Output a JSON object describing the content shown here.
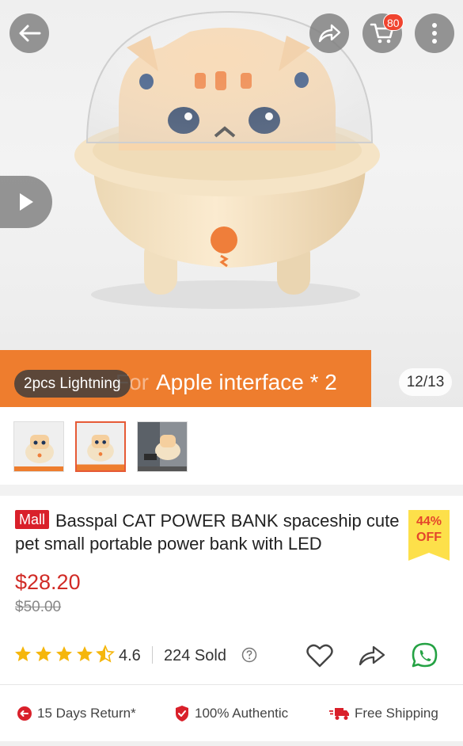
{
  "header": {
    "cart_count": "80"
  },
  "gallery": {
    "variant_label": "Apple interface * 2",
    "variant_ghost": "For",
    "variant_chip": "2pcs Lightning",
    "counter": "12/13"
  },
  "product": {
    "mall_tag": "Mall",
    "title": "Basspal CAT POWER BANK spaceship cute pet small portable power bank with LED",
    "discount_percent": "44%",
    "discount_label": "OFF",
    "price": "$28.20",
    "original_price": "$50.00",
    "rating": "4.6",
    "rating_fraction": 0.92,
    "sold": "224 Sold"
  },
  "guarantees": [
    {
      "label": "15 Days Return*",
      "icon": "return-icon"
    },
    {
      "label": "100% Authentic",
      "icon": "shield-check-icon"
    },
    {
      "label": "Free Shipping",
      "icon": "truck-icon"
    }
  ],
  "colors": {
    "accent_orange": "#ee7d2e",
    "price_red": "#d12b26",
    "mall_red": "#d9202a",
    "discount_yellow": "#fde04a",
    "whatsapp_green": "#25a244"
  }
}
